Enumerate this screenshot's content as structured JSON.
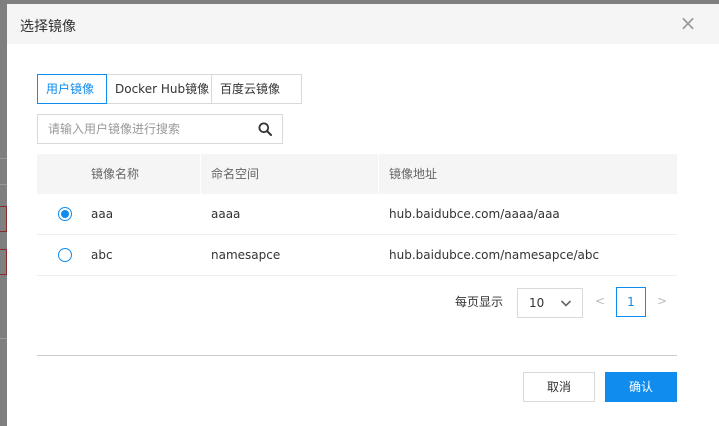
{
  "dialog": {
    "title": "选择镜像",
    "close_icon": "close-icon"
  },
  "tabs": [
    {
      "label": "用户镜像",
      "active": true
    },
    {
      "label": "Docker Hub镜像",
      "active": false
    },
    {
      "label": "百度云镜像",
      "active": false
    }
  ],
  "search": {
    "placeholder": "请输入用户镜像进行搜索",
    "value": "",
    "icon": "search-icon"
  },
  "table": {
    "columns": [
      "镜像名称",
      "命名空间",
      "镜像地址"
    ],
    "rows": [
      {
        "selected": true,
        "name": "aaa",
        "namespace": "aaaa",
        "address": "hub.baidubce.com/aaaa/aaa"
      },
      {
        "selected": false,
        "name": "abc",
        "namespace": "namesapce",
        "address": "hub.baidubce.com/namesapce/abc"
      }
    ]
  },
  "pagination": {
    "page_size_label": "每页显示",
    "page_size": "10",
    "prev": "<",
    "current_page": "1",
    "next": ">"
  },
  "footer": {
    "cancel_label": "取消",
    "ok_label": "确认"
  },
  "colors": {
    "accent": "#108cee",
    "header_bg": "#f5f5f5",
    "overlay": "#7f7f7f"
  }
}
